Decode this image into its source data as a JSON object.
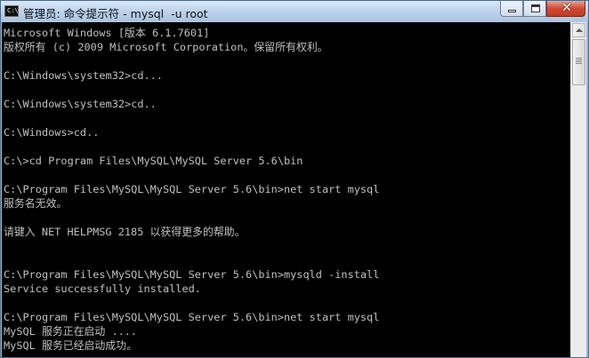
{
  "window": {
    "title": "管理员: 命令提示符 - mysql  -u root",
    "icon_name": "cmd-icon",
    "icon_text": "C:\\",
    "close_symbol": "✕"
  },
  "console": {
    "text_color": "#c0c0c0",
    "background": "#000000",
    "lines": [
      "Microsoft Windows [版本 6.1.7601]",
      "版权所有 (c) 2009 Microsoft Corporation。保留所有权利。",
      "",
      "C:\\Windows\\system32>cd...",
      "",
      "C:\\Windows\\system32>cd..",
      "",
      "C:\\Windows>cd..",
      "",
      "C:\\>cd Program Files\\MySQL\\MySQL Server 5.6\\bin",
      "",
      "C:\\Program Files\\MySQL\\MySQL Server 5.6\\bin>net start mysql",
      "服务名无效。",
      "",
      "请键入 NET HELPMSG 2185 以获得更多的帮助。",
      "",
      "",
      "C:\\Program Files\\MySQL\\MySQL Server 5.6\\bin>mysqld -install",
      "Service successfully installed.",
      "",
      "C:\\Program Files\\MySQL\\MySQL Server 5.6\\bin>net start mysql",
      "MySQL 服务正在启动 ....",
      "MySQL 服务已经启动成功。"
    ]
  }
}
